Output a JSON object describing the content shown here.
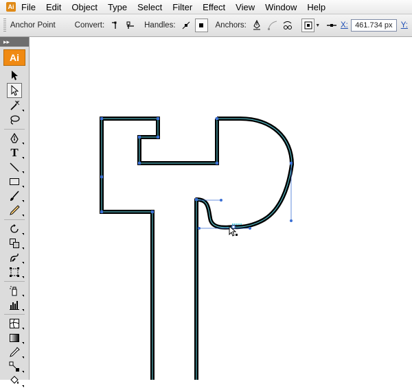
{
  "menu": {
    "app_icon": "Ai",
    "items": [
      "File",
      "Edit",
      "Object",
      "Type",
      "Select",
      "Filter",
      "Effect",
      "View",
      "Window",
      "Help"
    ]
  },
  "control_bar": {
    "tool_name": "Anchor Point",
    "convert_label": "Convert:",
    "handles_label": "Handles:",
    "anchors_label": "Anchors:",
    "x_label": "X:",
    "x_value": "461.734 px",
    "y_label": "Y:"
  },
  "tools_panel": {
    "collapse_glyph": "▸▸",
    "logo": "Ai",
    "tools": [
      "selection-tool",
      "direct-selection-tool",
      "magic-wand-tool",
      "lasso-tool",
      "pen-tool",
      "type-tool",
      "line-segment-tool",
      "rectangle-tool",
      "paintbrush-tool",
      "pencil-tool",
      "rotate-tool",
      "scale-tool",
      "warp-tool",
      "free-transform-tool",
      "symbol-sprayer-tool",
      "column-graph-tool",
      "mesh-tool",
      "gradient-tool",
      "eyedropper-tool",
      "blend-tool",
      "live-paint-tool"
    ],
    "active_tool": "direct-selection-tool",
    "type_tool_glyph": "T"
  },
  "colors": {
    "path_stroke": "#000000",
    "path_highlight": "#5fd3e0",
    "anchor_color": "#3b6fd4",
    "app_orange": "#f08a13"
  }
}
